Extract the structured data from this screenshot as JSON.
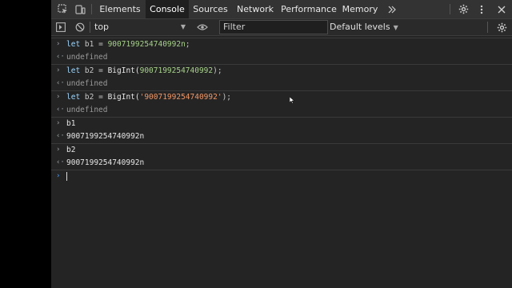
{
  "tabs": [
    {
      "label": "Elements"
    },
    {
      "label": "Console"
    },
    {
      "label": "Sources"
    },
    {
      "label": "Network"
    },
    {
      "label": "Performance"
    },
    {
      "label": "Memory"
    }
  ],
  "active_tab": "Console",
  "more_tabs_icon": "chevron-double-right-icon",
  "toolbar": {
    "context": "top",
    "filter_placeholder": "Filter",
    "levels": "Default levels"
  },
  "console": {
    "entries": [
      {
        "kind": "input",
        "kw": "let",
        "var": "b1",
        "op": "=",
        "val": "9007199254740992n",
        "tail": ";"
      },
      {
        "kind": "output",
        "text": "undefined"
      },
      {
        "kind": "input",
        "kw": "let",
        "var": "b2",
        "op": "=",
        "call": "BigInt(",
        "val": "9007199254740992",
        "tail": ");"
      },
      {
        "kind": "output",
        "text": "undefined"
      },
      {
        "kind": "input",
        "kw": "let",
        "var": "b2",
        "op": "=",
        "call": "BigInt(",
        "val": "'9007199254740992'",
        "tail": ");"
      },
      {
        "kind": "output",
        "text": "undefined"
      },
      {
        "kind": "input",
        "text": "b1"
      },
      {
        "kind": "output",
        "text": "9007199254740992n"
      },
      {
        "kind": "input",
        "text": "b2"
      },
      {
        "kind": "output",
        "text": "9007199254740992n"
      }
    ]
  }
}
